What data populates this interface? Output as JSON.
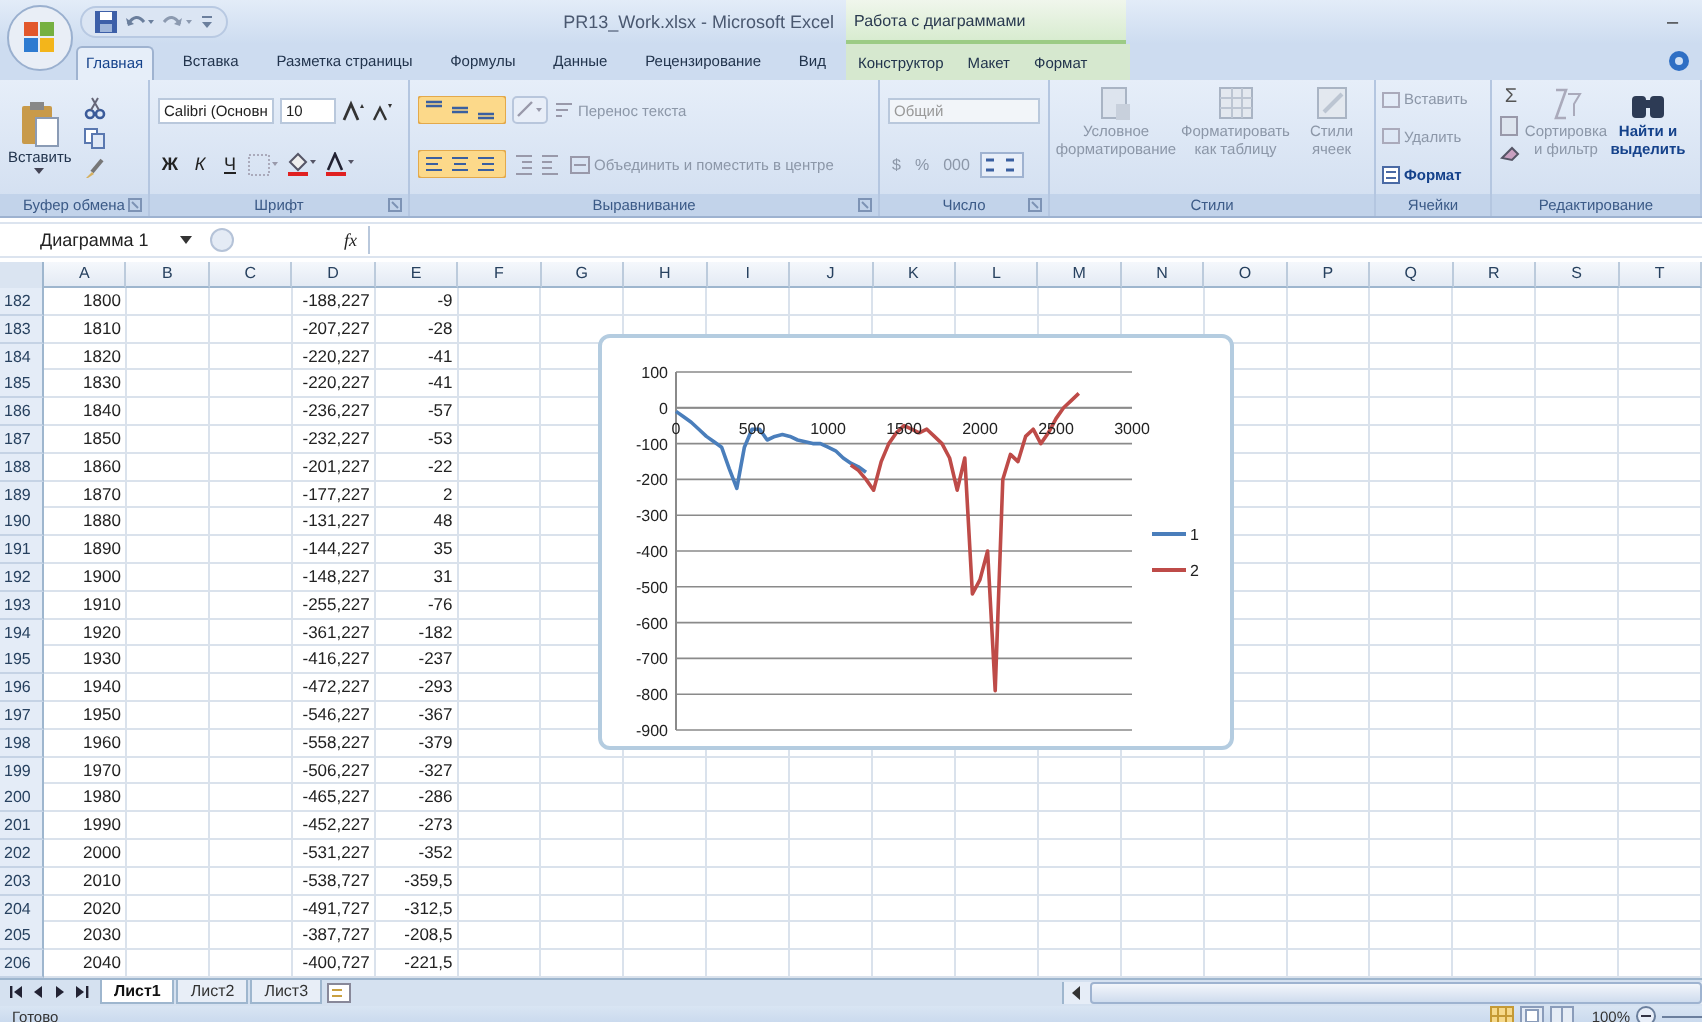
{
  "window": {
    "title": "PR13_Work.xlsx - Microsoft Excel",
    "context_group": "Работа с диаграммами",
    "minimize": "–"
  },
  "tabs": [
    {
      "label": "Главная",
      "selected": true
    },
    {
      "label": "Вставка",
      "selected": false
    },
    {
      "label": "Разметка страницы",
      "selected": false
    },
    {
      "label": "Формулы",
      "selected": false
    },
    {
      "label": "Данные",
      "selected": false
    },
    {
      "label": "Рецензирование",
      "selected": false
    },
    {
      "label": "Вид",
      "selected": false
    }
  ],
  "chart_tabs": [
    {
      "label": "Конструктор",
      "selected": false
    },
    {
      "label": "Макет",
      "selected": false
    },
    {
      "label": "Формат",
      "selected": false
    }
  ],
  "ribbon": {
    "clipboard": {
      "paste": "Вставить",
      "label": "Буфер обмена"
    },
    "font": {
      "name": "Calibri (Основн",
      "size": "10",
      "bold": "Ж",
      "italic": "К",
      "underline": "Ч",
      "label": "Шрифт"
    },
    "alignment": {
      "wrap": "Перенос текста",
      "merge": "Объединить и поместить в центре",
      "label": "Выравнивание"
    },
    "number": {
      "format": "Общий",
      "currency": "$",
      "percent": "%",
      "thousands": "000",
      "label": "Число"
    },
    "styles": {
      "conditional": "Условное форматирование",
      "table": "Форматировать как таблицу",
      "cell_styles": "Стили ячеек",
      "label": "Стили"
    },
    "cells": {
      "insert": "Вставить",
      "delete": "Удалить",
      "format": "Формат",
      "label": "Ячейки"
    },
    "editing": {
      "sum": "Σ",
      "sort": "Сортировка и фильтр",
      "find": "Найти и выделить",
      "label": "Редактирование"
    }
  },
  "formula_bar": {
    "name_box": "Диаграмма 1",
    "fx": "fx"
  },
  "sheet": {
    "columns": [
      "A",
      "B",
      "C",
      "D",
      "E",
      "F",
      "G",
      "H",
      "I",
      "J",
      "K",
      "L",
      "M",
      "N",
      "O",
      "P",
      "Q",
      "R",
      "S",
      "T"
    ],
    "rows": [
      {
        "header": "182",
        "a": "1800",
        "d": "-188,227",
        "e": "-9"
      },
      {
        "header": "183",
        "a": "1810",
        "d": "-207,227",
        "e": "-28"
      },
      {
        "header": "184",
        "a": "1820",
        "d": "-220,227",
        "e": "-41"
      },
      {
        "header": "185",
        "a": "1830",
        "d": "-220,227",
        "e": "-41"
      },
      {
        "header": "186",
        "a": "1840",
        "d": "-236,227",
        "e": "-57"
      },
      {
        "header": "187",
        "a": "1850",
        "d": "-232,227",
        "e": "-53"
      },
      {
        "header": "188",
        "a": "1860",
        "d": "-201,227",
        "e": "-22"
      },
      {
        "header": "189",
        "a": "1870",
        "d": "-177,227",
        "e": "2"
      },
      {
        "header": "190",
        "a": "1880",
        "d": "-131,227",
        "e": "48"
      },
      {
        "header": "191",
        "a": "1890",
        "d": "-144,227",
        "e": "35"
      },
      {
        "header": "192",
        "a": "1900",
        "d": "-148,227",
        "e": "31"
      },
      {
        "header": "193",
        "a": "1910",
        "d": "-255,227",
        "e": "-76"
      },
      {
        "header": "194",
        "a": "1920",
        "d": "-361,227",
        "e": "-182"
      },
      {
        "header": "195",
        "a": "1930",
        "d": "-416,227",
        "e": "-237"
      },
      {
        "header": "196",
        "a": "1940",
        "d": "-472,227",
        "e": "-293"
      },
      {
        "header": "197",
        "a": "1950",
        "d": "-546,227",
        "e": "-367"
      },
      {
        "header": "198",
        "a": "1960",
        "d": "-558,227",
        "e": "-379"
      },
      {
        "header": "199",
        "a": "1970",
        "d": "-506,227",
        "e": "-327"
      },
      {
        "header": "200",
        "a": "1980",
        "d": "-465,227",
        "e": "-286"
      },
      {
        "header": "201",
        "a": "1990",
        "d": "-452,227",
        "e": "-273"
      },
      {
        "header": "202",
        "a": "2000",
        "d": "-531,227",
        "e": "-352"
      },
      {
        "header": "203",
        "a": "2010",
        "d": "-538,727",
        "e": "-359,5"
      },
      {
        "header": "204",
        "a": "2020",
        "d": "-491,727",
        "e": "-312,5"
      },
      {
        "header": "205",
        "a": "2030",
        "d": "-387,727",
        "e": "-208,5"
      },
      {
        "header": "206",
        "a": "2040",
        "d": "-400,727",
        "e": "-221,5"
      }
    ],
    "chart": {
      "chart_data": {
        "type": "line",
        "x": [
          0,
          50,
          100,
          150,
          200,
          250,
          300,
          350,
          400,
          450,
          500,
          550,
          600,
          650,
          700,
          750,
          800,
          850,
          900,
          950,
          1000,
          1050,
          1100,
          1150,
          1200,
          1250,
          1300,
          1350,
          1400,
          1450,
          1500,
          1550,
          1600,
          1650,
          1700,
          1750,
          1800,
          1850,
          1900,
          1950,
          2000,
          2050,
          2100,
          2150,
          2200,
          2250,
          2300,
          2350,
          2400,
          2450,
          2500,
          2550,
          2600,
          2650
        ],
        "series": [
          {
            "name": "1",
            "color": "#4a7ebb",
            "values": [
              -10,
              -25,
              -40,
              -60,
              -80,
              -95,
              -110,
              -170,
              -225,
              -110,
              -60,
              -60,
              -90,
              -80,
              -75,
              -80,
              -90,
              -95,
              -100,
              -100,
              -110,
              -120,
              -140,
              -155,
              -165,
              -180,
              null,
              null,
              null,
              null,
              null,
              null,
              null,
              null,
              null,
              null,
              null,
              null,
              null,
              null,
              null,
              null,
              null,
              null,
              null,
              null,
              null,
              null,
              null,
              null,
              null,
              null,
              null,
              null
            ]
          },
          {
            "name": "2",
            "color": "#be4b48",
            "values": [
              null,
              null,
              null,
              null,
              null,
              null,
              null,
              null,
              null,
              null,
              null,
              null,
              null,
              null,
              null,
              null,
              null,
              null,
              null,
              null,
              null,
              null,
              null,
              -160,
              -175,
              -200,
              -230,
              -150,
              -100,
              -70,
              -50,
              -60,
              -70,
              -60,
              -80,
              -100,
              -140,
              -230,
              -140,
              -520,
              -480,
              -400,
              -790,
              -200,
              -130,
              -150,
              -80,
              -60,
              -100,
              -70,
              -30,
              0,
              20,
              40
            ]
          }
        ],
        "grid": true,
        "legend": true,
        "xlim": [
          0,
          3000
        ],
        "ylim": [
          -900,
          100
        ],
        "xticks": [
          0,
          500,
          1000,
          1500,
          2000,
          2500,
          3000
        ],
        "yticks": [
          100,
          0,
          -100,
          -200,
          -300,
          -400,
          -500,
          -600,
          -700,
          -800,
          -900
        ]
      }
    }
  },
  "sheet_tabs": [
    {
      "label": "Лист1",
      "selected": true
    },
    {
      "label": "Лист2",
      "selected": false
    },
    {
      "label": "Лист3",
      "selected": false
    }
  ],
  "status_bar": {
    "text": "Готово",
    "zoom": "100%"
  }
}
